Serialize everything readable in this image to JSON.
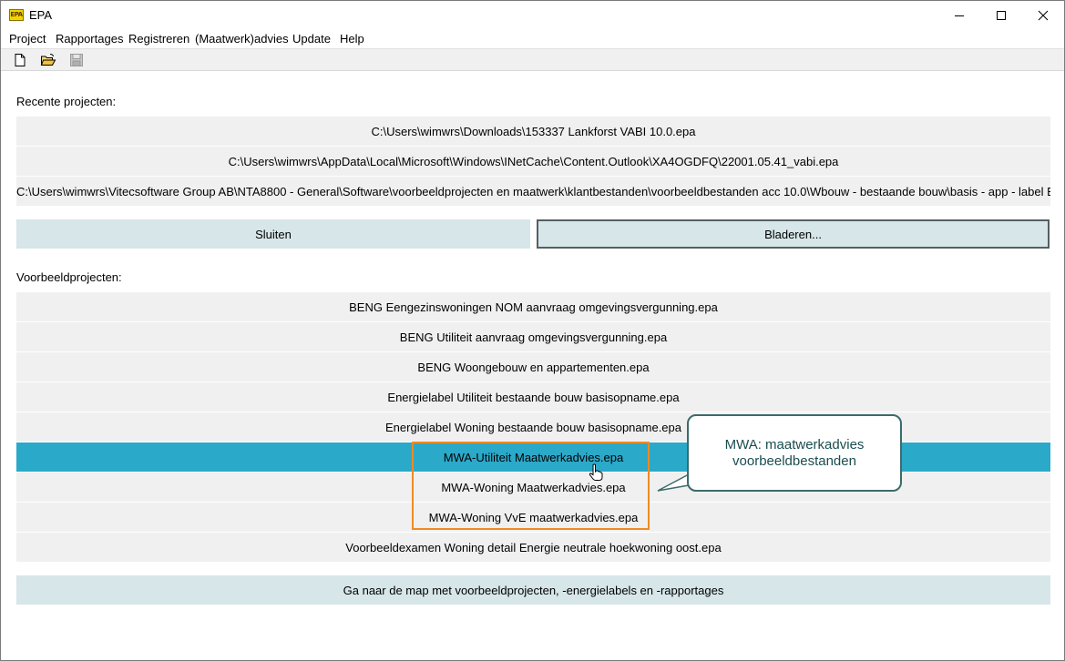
{
  "window": {
    "title": "EPA",
    "app_icon_text": "EPA"
  },
  "menu": {
    "items": [
      "Project",
      "Rapportages",
      "Registreren",
      "(Maatwerk)advies",
      "Update",
      "Help"
    ]
  },
  "toolbar": {
    "buttons": [
      "new-document-icon",
      "open-folder-icon",
      "save-icon"
    ]
  },
  "recent": {
    "label": "Recente projecten:",
    "items": [
      "C:\\Users\\wimwrs\\Downloads\\153337 Lankforst VABI 10.0.epa",
      "C:\\Users\\wimwrs\\AppData\\Local\\Microsoft\\Windows\\INetCache\\Content.Outlook\\XA4OGDFQ\\22001.05.41_vabi.epa",
      "C:\\Users\\wimwrs\\Vitecsoftware Group AB\\NTA8800 - General\\Software\\voorbeeldprojecten en maatwerk\\klantbestanden\\voorbeeldbestanden acc 10.0\\Wbouw - bestaande bouw\\basis - app - label E"
    ]
  },
  "actions": {
    "close_label": "Sluiten",
    "browse_label": "Bladeren..."
  },
  "examples": {
    "label": "Voorbeeldprojecten:",
    "items": [
      "BENG Eengezinswoningen NOM aanvraag omgevingsvergunning.epa",
      "BENG Utiliteit aanvraag omgevingsvergunning.epa",
      "BENG Woongebouw en appartementen.epa",
      "Energielabel Utiliteit bestaande bouw basisopname.epa",
      "Energielabel Woning bestaande bouw basisopname.epa",
      "MWA-Utiliteit Maatwerkadvies.epa",
      "MWA-Woning Maatwerkadvies.epa",
      "MWA-Woning VvE maatwerkadvies.epa",
      "Voorbeeldexamen Woning detail Energie neutrale hoekwoning oost.epa"
    ],
    "selected_index": 5,
    "folder_button_label": "Ga naar de map met voorbeeldprojecten, -energielabels en -rapportages"
  },
  "callout": {
    "line1": "MWA: maatwerkadvies",
    "line2": "voorbeeldbestanden"
  },
  "colors": {
    "selected_row": "#2ba9c9",
    "button_bg": "#d6e6e9",
    "highlight_border": "#f08a24",
    "callout_border": "#3c6b6b"
  }
}
